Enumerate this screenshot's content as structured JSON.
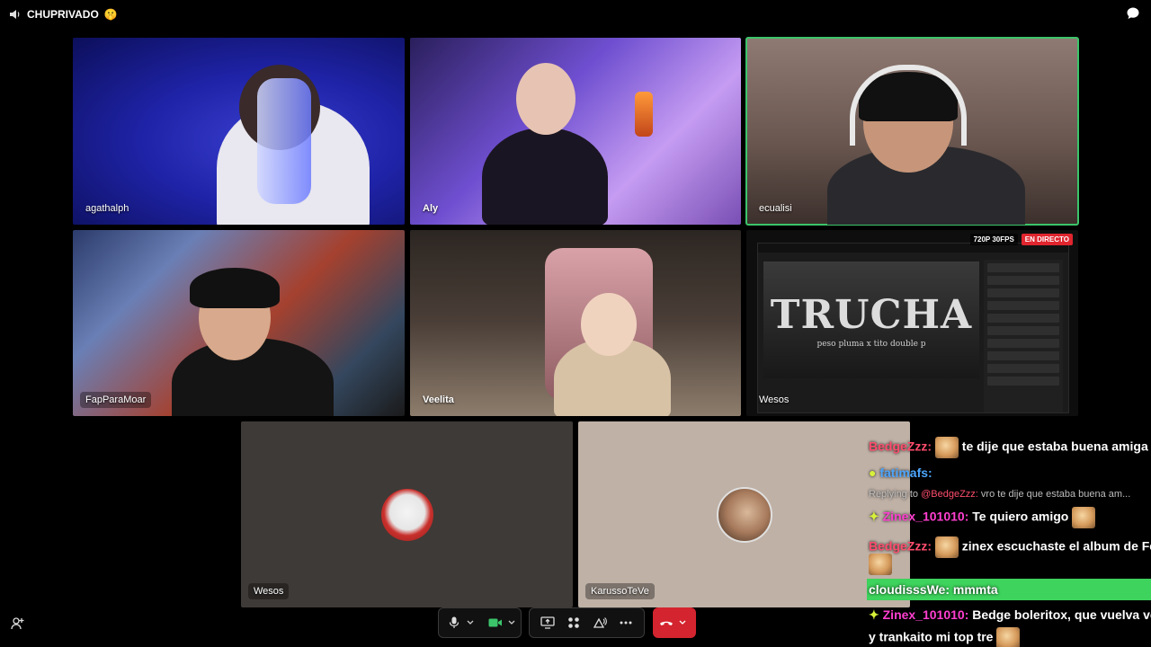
{
  "topbar": {
    "title": "CHUPRIVADO",
    "title_emoji": "🤫",
    "speaker_icon": "volume-icon",
    "chat_icon": "chat-bubble-icon"
  },
  "participants": {
    "agathalph": "agathalph",
    "aly": "Aly",
    "ecualisi": "ecualisi",
    "fap": "FapParaMoar",
    "veelita": "Veelita",
    "wesos_stream": "Wesos",
    "wesos": "Wesos",
    "karusso": "KarussoTeVe"
  },
  "stream": {
    "resolution_badge": "720P 30FPS",
    "live_badge": "EN DIRECTO",
    "video_title": "TRUCHA",
    "video_subtitle": "peso pluma x tito double p"
  },
  "chat": [
    {
      "user": "BedgeZzz:",
      "text": "te dije que estaba buena amiga"
    },
    {
      "user": "fatimafs:",
      "text": ""
    },
    {
      "reply_prefix": "Replying to",
      "reply_mention": "@BedgeZzz:",
      "reply_text": "vro te dije que estaba buena am..."
    },
    {
      "user": "Zinex_101010:",
      "text": "Te quiero amigo"
    },
    {
      "user": "BedgeZzz:",
      "text": "zinex escuchaste el album de Feid"
    },
    {
      "user": "cloudisssWe:",
      "text": "mmmta"
    },
    {
      "user": "Zinex_101010:",
      "text": "Bedge boleritox, que vuelva vox"
    },
    {
      "continuation": "y trankaito mi top tre"
    }
  ],
  "colors": {
    "speaking_border": "#3bc46a",
    "hangup": "#d4242f",
    "live_badge": "#e0252e",
    "chat_highlight": "#3dd35c"
  }
}
